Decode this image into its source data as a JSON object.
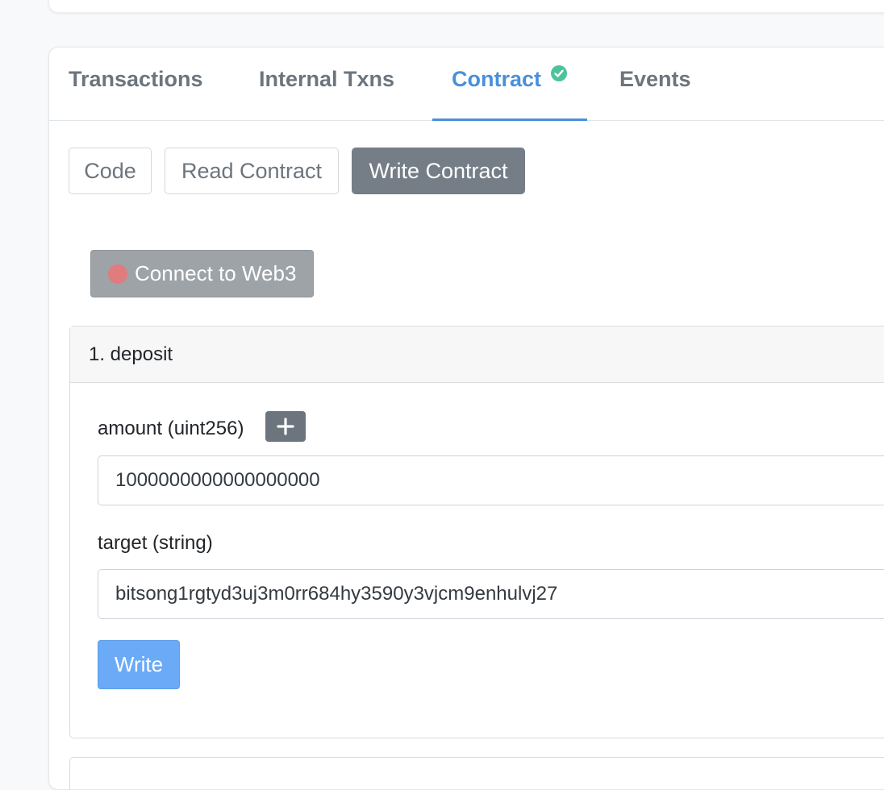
{
  "tabs": [
    {
      "label": "Transactions"
    },
    {
      "label": "Internal Txns"
    },
    {
      "label": "Contract",
      "active": true
    },
    {
      "label": "Events"
    }
  ],
  "contract_tabs": [
    {
      "label": "Code"
    },
    {
      "label": "Read Contract"
    },
    {
      "label": "Write Contract",
      "active": true
    }
  ],
  "web3": {
    "label": "Connect to Web3",
    "status": "disconnected",
    "status_color": "#e07b7e"
  },
  "function": {
    "title": "1. deposit",
    "fields": [
      {
        "label": "amount (uint256)",
        "value": "1000000000000000000"
      },
      {
        "label": "target (string)",
        "value": "bitsong1rgtyd3uj3m0rr684hy3590y3vjcm9enhulvj27"
      }
    ],
    "write_label": "Write"
  },
  "icons": {
    "verified": "check-circle-icon",
    "add": "plus-icon"
  },
  "colors": {
    "accent": "#4a90d9",
    "verified": "#4cc49a",
    "write_button": "#6aaaf7",
    "active_subtab": "#757e87"
  }
}
